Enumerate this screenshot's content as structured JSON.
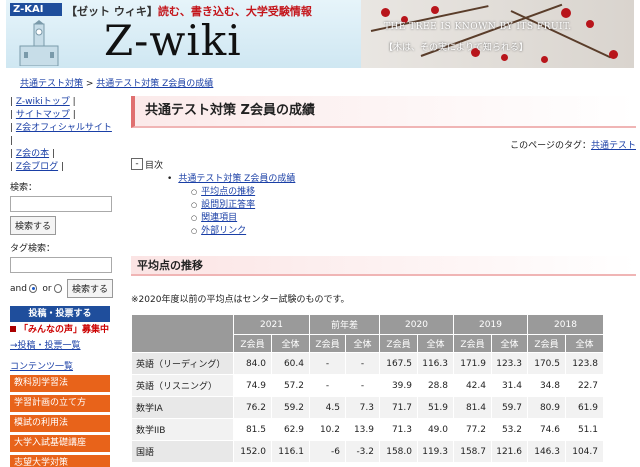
{
  "banner": {
    "logo": "Z-KAI",
    "tagline_bracket": "【ゼット ウィキ】",
    "tagline_text": "読む、書き込む、大学受験情報",
    "site_title": "Z-wiki",
    "motto": "THE TREE IS KNOWN BY ITS FRUIT.",
    "motto_jp": "【木は、その実によりて知られる】"
  },
  "breadcrumb": {
    "root": "共通テスト対策",
    "separator": " > ",
    "current": "共通テスト対策 Z会員の成績"
  },
  "sidebar": {
    "links": [
      "Z-wikiトップ",
      "サイトマップ",
      "Z会オフィシャルサイト",
      "Z会の本",
      "Z会ブログ"
    ],
    "search_label": "検索：",
    "search_button": "検索する",
    "tag_search_label": "タグ検索：",
    "and_label": "and",
    "or_label": "or",
    "tag_search_button": "検索する",
    "post_button": "投稿・投票する",
    "voice_title": "「みんなの声」募集中",
    "post_list": "→投稿・投票一覧",
    "contents_head": "コンテンツ一覧",
    "menu": [
      "教科別学習法",
      "学習計画の立て方",
      "模試の利用法",
      "大学入試基礎講座",
      "志望大学対策"
    ]
  },
  "main": {
    "title": "共通テスト対策 Z会員の成績",
    "tag_label": "このページのタグ：",
    "tag_value": "共通テスト",
    "toc": {
      "toggle": "-",
      "label": "目次",
      "root": "共通テスト対策 Z会員の成績",
      "items": [
        "平均点の推移",
        "設問別正答率",
        "関連項目",
        "外部リンク"
      ]
    },
    "section_title": "平均点の推移",
    "note": "※2020年度以前の平均点はセンター試験のものです。"
  },
  "table": {
    "years": [
      "2021",
      "前年差",
      "2020",
      "2019",
      "2018"
    ],
    "sub": [
      "Z会員",
      "全体",
      "Z会員",
      "全体",
      "Z会員",
      "全体",
      "Z会員",
      "全体",
      "Z会員",
      "全体"
    ],
    "rows": [
      {
        "subject": "英語（リーディング）",
        "cells": [
          "84.0",
          "60.4",
          "-",
          "-",
          "167.5",
          "116.3",
          "171.9",
          "123.3",
          "170.5",
          "123.8"
        ]
      },
      {
        "subject": "英語（リスニング）",
        "cells": [
          "74.9",
          "57.2",
          "-",
          "-",
          "39.9",
          "28.8",
          "42.4",
          "31.4",
          "34.8",
          "22.7"
        ]
      },
      {
        "subject": "数学IA",
        "cells": [
          "76.2",
          "59.2",
          "4.5",
          "7.3",
          "71.7",
          "51.9",
          "81.4",
          "59.7",
          "80.9",
          "61.9"
        ]
      },
      {
        "subject": "数学IIB",
        "cells": [
          "81.5",
          "62.9",
          "10.2",
          "13.9",
          "71.3",
          "49.0",
          "77.2",
          "53.2",
          "74.6",
          "51.1"
        ]
      },
      {
        "subject": "国語",
        "cells": [
          "152.0",
          "116.1",
          "-6",
          "-3.2",
          "158.0",
          "119.3",
          "158.7",
          "121.6",
          "146.3",
          "104.7"
        ]
      }
    ]
  }
}
